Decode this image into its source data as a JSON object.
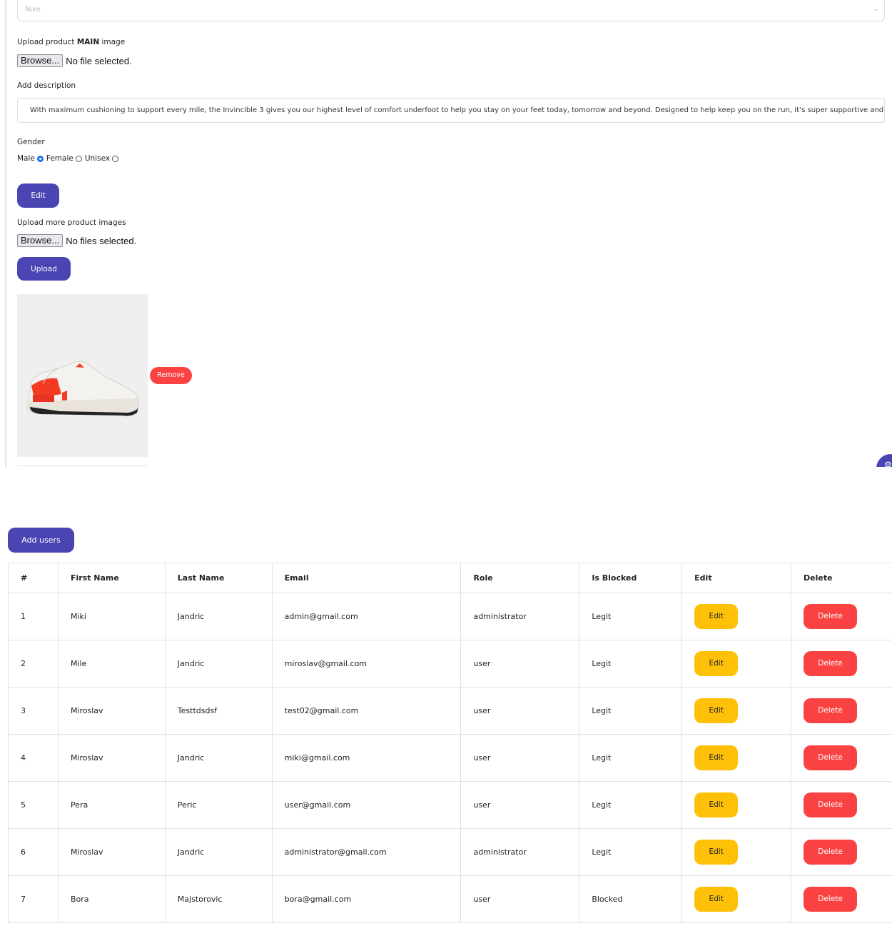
{
  "product_form": {
    "brand_select": {
      "value": "Nike"
    },
    "main_image": {
      "label_prefix": "Upload product ",
      "label_strong": "MAIN",
      "label_suffix": " image",
      "browse_label": "Browse...",
      "status": "No file selected."
    },
    "description": {
      "label": "Add description",
      "value": "With maximum cushioning to support every mile, the Invincible 3 gives you our highest level of comfort underfoot to help you stay on your feet today, tomorrow and beyond. Designed to help keep you on the run, it’s super supportive and boun"
    },
    "gender": {
      "label": "Gender",
      "options": [
        {
          "label": "Male",
          "checked": true
        },
        {
          "label": "Female",
          "checked": false
        },
        {
          "label": "Unisex",
          "checked": false
        }
      ]
    },
    "edit_label": "Edit",
    "more_images": {
      "label": "Upload more product images",
      "browse_label": "Browse...",
      "status": "No files selected."
    },
    "upload_label": "Upload",
    "remove_label": "Remove"
  },
  "users": {
    "add_label": "Add users",
    "columns": [
      "#",
      "First Name",
      "Last Name",
      "Email",
      "Role",
      "Is Blocked",
      "Edit",
      "Delete"
    ],
    "edit_label": "Edit",
    "delete_label": "Delete",
    "rows": [
      {
        "id": "1",
        "first": "Miki",
        "last": "Jandric",
        "email": "admin@gmail.com",
        "role": "administrator",
        "status": "Legit"
      },
      {
        "id": "2",
        "first": "Mile",
        "last": "Jandric",
        "email": "miroslav@gmail.com",
        "role": "user",
        "status": "Legit"
      },
      {
        "id": "3",
        "first": "Miroslav",
        "last": "Testtdsdsf",
        "email": "test02@gmail.com",
        "role": "user",
        "status": "Legit"
      },
      {
        "id": "4",
        "first": "Miroslav",
        "last": "Jandric",
        "email": "miki@gmail.com",
        "role": "user",
        "status": "Legit"
      },
      {
        "id": "5",
        "first": "Pera",
        "last": "Peric",
        "email": "user@gmail.com",
        "role": "user",
        "status": "Legit"
      },
      {
        "id": "6",
        "first": "Miroslav",
        "last": "Jandric",
        "email": "administrator@gmail.com",
        "role": "administrator",
        "status": "Legit"
      },
      {
        "id": "7",
        "first": "Bora",
        "last": "Majstorovic",
        "email": "bora@gmail.com",
        "role": "user",
        "status": "Blocked"
      }
    ]
  },
  "colors": {
    "primary": "#4a45b3",
    "danger": "#fb4242",
    "warning": "#ffc107",
    "radio_checked": "#1a73e8"
  },
  "icons": {
    "select_chevron": "chevron-down-icon",
    "fab": "gear-icon"
  }
}
